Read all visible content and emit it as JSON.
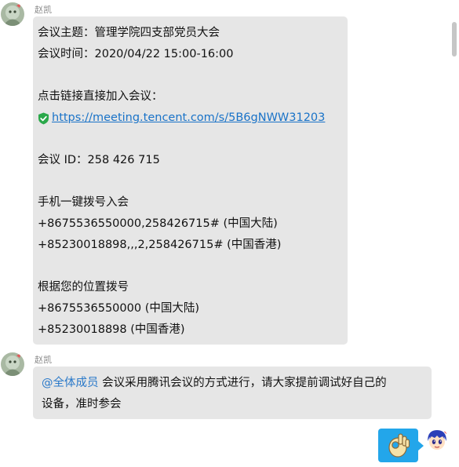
{
  "messages": [
    {
      "sender": "赵凯",
      "lines": {
        "topic": "会议主题：管理学院四支部党员大会",
        "time": "会议时间：2020/04/22 15:00-16:00",
        "join_prompt": "点击链接直接加入会议：",
        "link": "https://meeting.tencent.com/s/5B6gNWW31203",
        "meeting_id": "会议 ID：258 426 715",
        "onetap_title": "手机一键拨号入会",
        "onetap_1": "+8675536550000,258426715# (中国大陆)",
        "onetap_2": "+85230018898,,,2,258426715# (中国香港)",
        "location_title": "根据您的位置拨号",
        "location_1": "+8675536550000 (中国大陆)",
        "location_2": "+85230018898 (中国香港)"
      },
      "link_icon": "green-shield-check-icon"
    },
    {
      "sender": "赵凯",
      "mention": "@全体成员",
      "line1": " 会议采用腾讯会议的方式进行，请大家提前调试好自己的",
      "line2": "设备，准时参会"
    },
    {
      "emoji": "ok-hand-emoji",
      "avatar": "cartoon-blue-hair-avatar"
    }
  ],
  "colors": {
    "bubble_gray": "#e6e6e6",
    "link_blue": "#1a73c8",
    "mention_blue": "#2a79c9",
    "emoji_bubble_blue": "#23a6ea",
    "shield_green": "#2aa84a"
  }
}
